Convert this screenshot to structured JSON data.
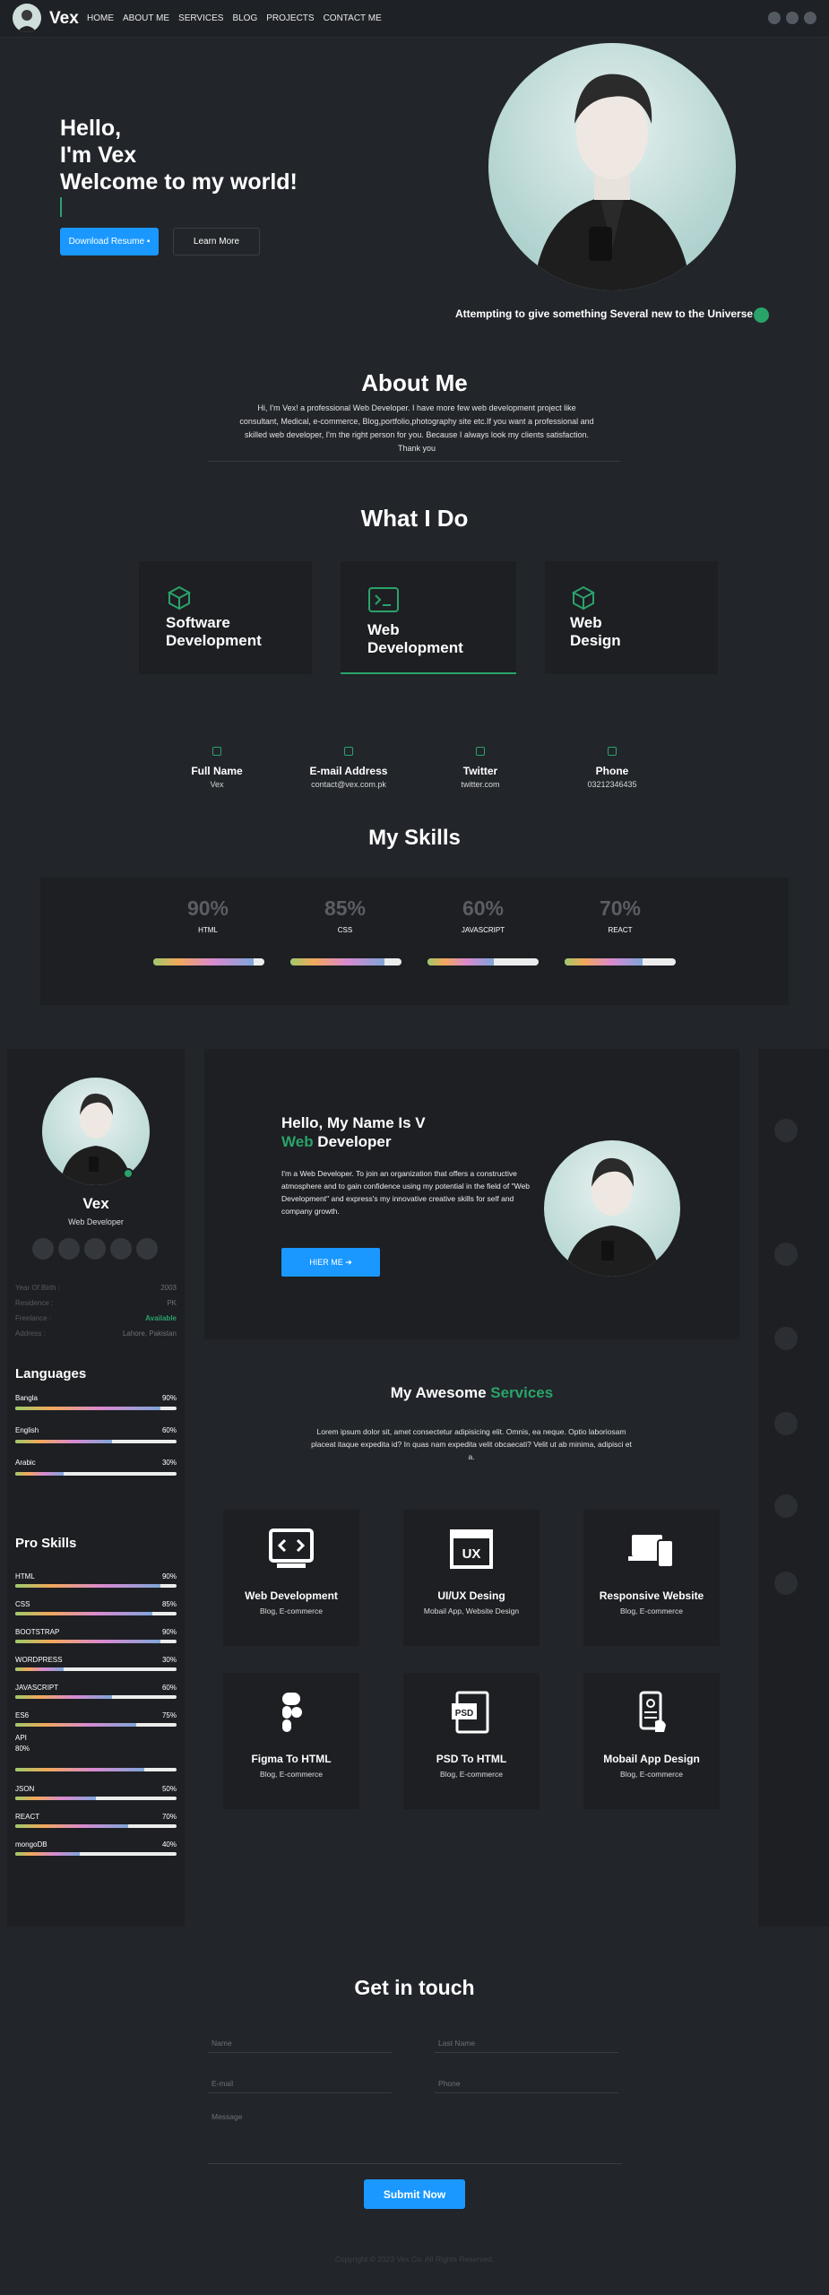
{
  "nav": {
    "brand": "Vex",
    "items": [
      "HOME",
      "ABOUT ME",
      "SERVICES",
      "BLOG",
      "PROJECTS",
      "CONTACT ME"
    ],
    "social_icons": [
      "facebook-icon",
      "github-icon",
      "linkedin-icon"
    ]
  },
  "hero": {
    "line1": "Hello,",
    "line2": "I'm Vex",
    "line3": "Welcome to my world!",
    "download_label": "Download Resume",
    "learn_label": "Learn More",
    "caption": "Attempting to give something Several new to the Universe"
  },
  "about": {
    "title": "About Me",
    "text": "Hi, I'm Vex! a professional Web Developer. I have more few web development project like consultant, Medical, e-commerce, Blog,portfolio,photography site etc.If you want a professional and skilled web developer, I'm the right person for you. Because I always look my clients satisfaction. Thank you"
  },
  "what_i_do": {
    "title": "What I Do",
    "cards": [
      {
        "l1": "Software",
        "l2": "Development"
      },
      {
        "l1": "Web",
        "l2": "Development"
      },
      {
        "l1": "Web",
        "l2": "Design"
      }
    ]
  },
  "contact_info": [
    {
      "title": "Full Name",
      "value": "Vex",
      "icon": "user-icon"
    },
    {
      "title": "E-mail Address",
      "value": "contact@vex.com.pk",
      "icon": "home-icon"
    },
    {
      "title": "Twitter",
      "value": "twitter.com",
      "icon": "twitter-icon"
    },
    {
      "title": "Phone",
      "value": "03212346435",
      "icon": "phone-icon"
    }
  ],
  "skills": {
    "title": "My Skills",
    "items": [
      {
        "percent": "90%",
        "name": "HTML",
        "value": 90
      },
      {
        "percent": "85%",
        "name": "CSS",
        "value": 85
      },
      {
        "percent": "60%",
        "name": "JAVASCRIPT",
        "value": 60
      },
      {
        "percent": "70%",
        "name": "REACT",
        "value": 70
      }
    ]
  },
  "sidebar": {
    "name": "Vex",
    "role": "Web Developer",
    "info": [
      {
        "label": "Year Of Birth :",
        "value": "2003"
      },
      {
        "label": "Residence :",
        "value": "PK"
      },
      {
        "label": "Freelance :",
        "value": "Available"
      },
      {
        "label": "Address :",
        "value": "Lahore, Pakistan"
      }
    ],
    "languages_title": "Languages",
    "languages": [
      {
        "name": "Bangla",
        "percent": "90%",
        "value": 90
      },
      {
        "name": "English",
        "percent": "60%",
        "value": 60
      },
      {
        "name": "Arabic",
        "percent": "30%",
        "value": 30
      }
    ],
    "pro_title": "Pro Skills",
    "pro_skills": [
      {
        "name": "HTML",
        "percent": "90%",
        "value": 90
      },
      {
        "name": "CSS",
        "percent": "85%",
        "value": 85
      },
      {
        "name": "BOOTSTRAP",
        "percent": "90%",
        "value": 90
      },
      {
        "name": "WORDPRESS",
        "percent": "30%",
        "value": 30
      },
      {
        "name": "JAVASCRIPT",
        "percent": "60%",
        "value": 60
      },
      {
        "name": "ES6",
        "percent": "75%",
        "value": 75
      },
      {
        "name": "API",
        "percent": "80%",
        "value": 80
      },
      {
        "name": "JSON",
        "percent": "50%",
        "value": 50
      },
      {
        "name": "REACT",
        "percent": "70%",
        "value": 70
      },
      {
        "name": "mongoDB",
        "percent": "40%",
        "value": 40
      }
    ]
  },
  "intro": {
    "line1": "Hello, My Name Is V",
    "line2a": "Web",
    "line2b": " Developer",
    "text": "I'm a Web Developer. To join an organization that offers a constructive atmosphere and to gain confidence using my potential in the field of \"Web Development\" and express's my innovative creative skills for self and company growth.",
    "hire_label": "HIER ME"
  },
  "services": {
    "title_a": "My Awesome ",
    "title_b": "Services",
    "desc": "Lorem ipsum dolor sit, amet consectetur adipisicing elit. Omnis, ea neque. Optio laboriosam placeat itaque expedita id? In quas nam expedita velit obcaecati? Velit ut ab minima, adipisci et a.",
    "cards": [
      {
        "title": "Web Development",
        "sub": "Blog, E-commerce",
        "icon": "code-window-icon"
      },
      {
        "title": "UI/UX Desing",
        "sub": "Mobail App, Website Design",
        "icon": "ux-icon"
      },
      {
        "title": "Responsive Website",
        "sub": "Blog, E-commerce",
        "icon": "devices-icon"
      },
      {
        "title": "Figma To HTML",
        "sub": "Blog, E-commerce",
        "icon": "figma-icon"
      },
      {
        "title": "PSD To HTML",
        "sub": "Blog, E-commerce",
        "icon": "psd-icon"
      },
      {
        "title": "Mobail App Design",
        "sub": "Blog, E-commerce",
        "icon": "mobile-app-icon"
      }
    ]
  },
  "contact": {
    "title": "Get in touch",
    "name_ph": "Name",
    "last_ph": "Last Name",
    "email_ph": "E-mail",
    "phone_ph": "Phone",
    "message_ph": "Message",
    "submit_label": "Submit Now"
  },
  "footer": {
    "copyright": "Copyright © 2023 Vex Co. All Rights Reserved."
  },
  "colors": {
    "accent": "#2aa36a",
    "primary": "#1a98ff",
    "background": "#22252a",
    "panel": "#1d1f23"
  }
}
